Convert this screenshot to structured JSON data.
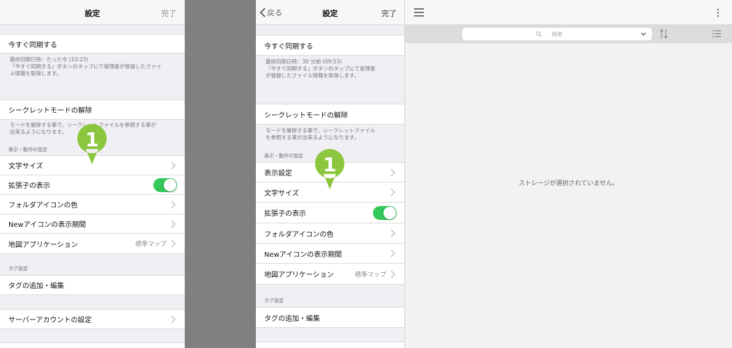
{
  "left": {
    "nav": {
      "title": "設定",
      "done": "完了"
    },
    "sync": {
      "label": "今すぐ同期する",
      "note_line1": "最終同期日時：たった今 (10:23)",
      "note_line2": "「今すぐ同期する」ボタンのタップにて管理者が登録したファイ",
      "note_line3": "ル情報を取得します。"
    },
    "secret": {
      "label": "シークレットモードの解除",
      "note_line1": "モードを解除する事で、シークレットファイルを参照する事が",
      "note_line2": "出来るようになります。"
    },
    "display_section": "表示・動作の設定",
    "rows": {
      "font_size": "文字サイズ",
      "extension": "拡張子の表示",
      "folder_icon": "フォルダアイコンの色",
      "new_icon": "Newアイコンの表示期間",
      "map_app": "地図アプリケーション",
      "map_value": "標準マップ"
    },
    "tag_section": "タグ設定",
    "tag_edit": "タグの追加・編集",
    "server_account": "サーバーアカウントの設定",
    "marker": "1"
  },
  "middle": {
    "nav": {
      "back": "戻る",
      "title": "設定",
      "done": "完了"
    },
    "sync": {
      "label": "今すぐ同期する",
      "note_line1": "最終同期日時：30 分前 (09:53)",
      "note_line2": "「今すぐ同期する」ボタンのタップにて管理者",
      "note_line3": "が登録したファイル情報を取得します。"
    },
    "secret": {
      "label": "シークレットモードの解除",
      "note_line1": "モードを解除する事で、シークレットファイル",
      "note_line2": "を参照する事が出来るようになります。"
    },
    "display_section": "表示・動作の設定",
    "rows": {
      "display_settings": "表示設定",
      "font_size": "文字サイズ",
      "extension": "拡張子の表示",
      "folder_icon": "フォルダアイコンの色",
      "new_icon": "Newアイコンの表示期間",
      "map_app": "地図アプリケーション",
      "map_value": "標準マップ"
    },
    "tag_section": "タグ設定",
    "tag_edit": "タグの追加・編集",
    "marker": "1"
  },
  "right": {
    "search_placeholder": "検索",
    "empty_message": "ストレージが選択されていません。"
  },
  "colors": {
    "toggle_on": "#34c759",
    "marker": "#8cc63f"
  },
  "icons": [
    "chevron-right-icon",
    "back-chevron-icon",
    "hamburger-menu-icon",
    "more-vert-icon",
    "search-icon",
    "chevron-down-icon",
    "sort-icon",
    "list-view-icon"
  ]
}
